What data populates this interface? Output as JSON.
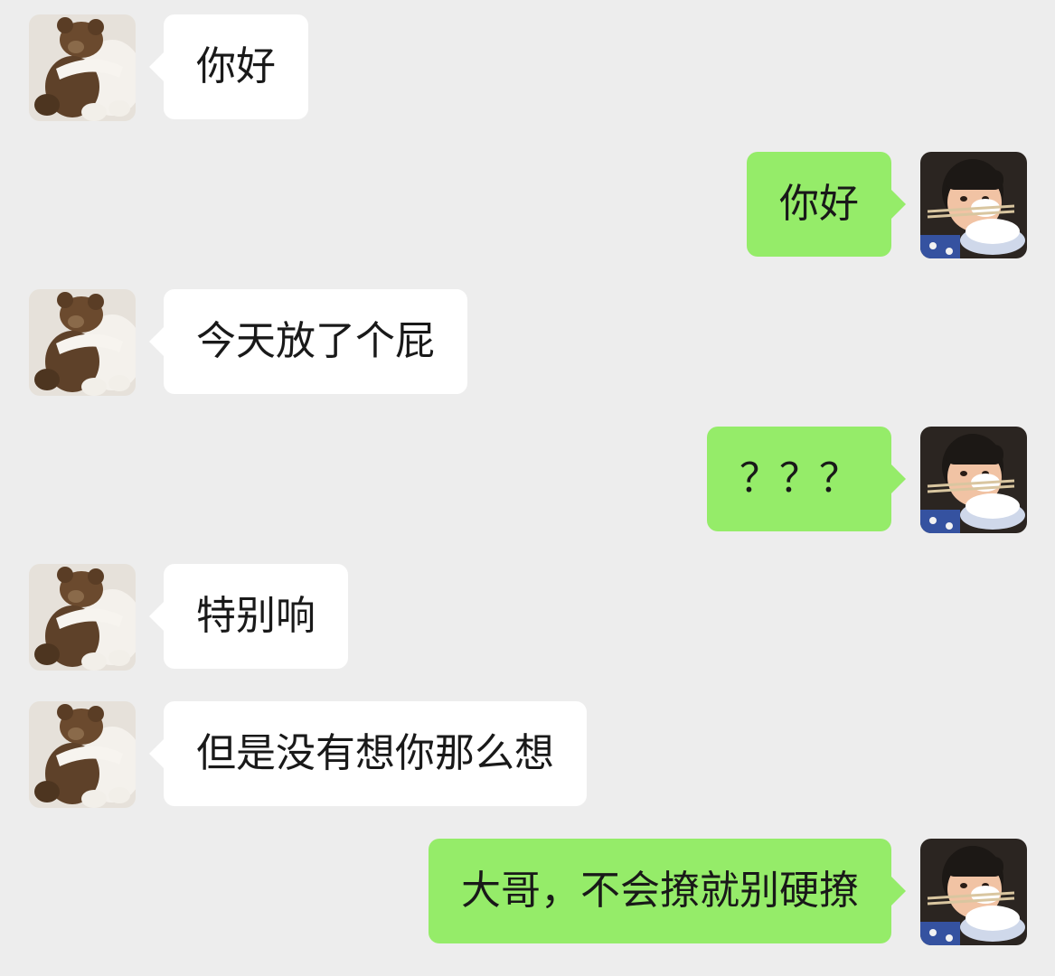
{
  "theme": {
    "background": "#ededed",
    "incoming_bubble": "#ffffff",
    "outgoing_bubble": "#95ec69",
    "text_color": "#191919"
  },
  "contact": {
    "avatar_icon": "teddy-bear-avatar-icon"
  },
  "self": {
    "avatar_icon": "child-eating-rice-avatar-icon"
  },
  "messages": [
    {
      "side": "left",
      "text": "你好"
    },
    {
      "side": "right",
      "text": "你好"
    },
    {
      "side": "left",
      "text": "今天放了个屁"
    },
    {
      "side": "right",
      "text": "？？？"
    },
    {
      "side": "left",
      "text": "特别响"
    },
    {
      "side": "left",
      "text": "但是没有想你那么想"
    },
    {
      "side": "right",
      "text": "大哥，不会撩就别硬撩"
    }
  ]
}
